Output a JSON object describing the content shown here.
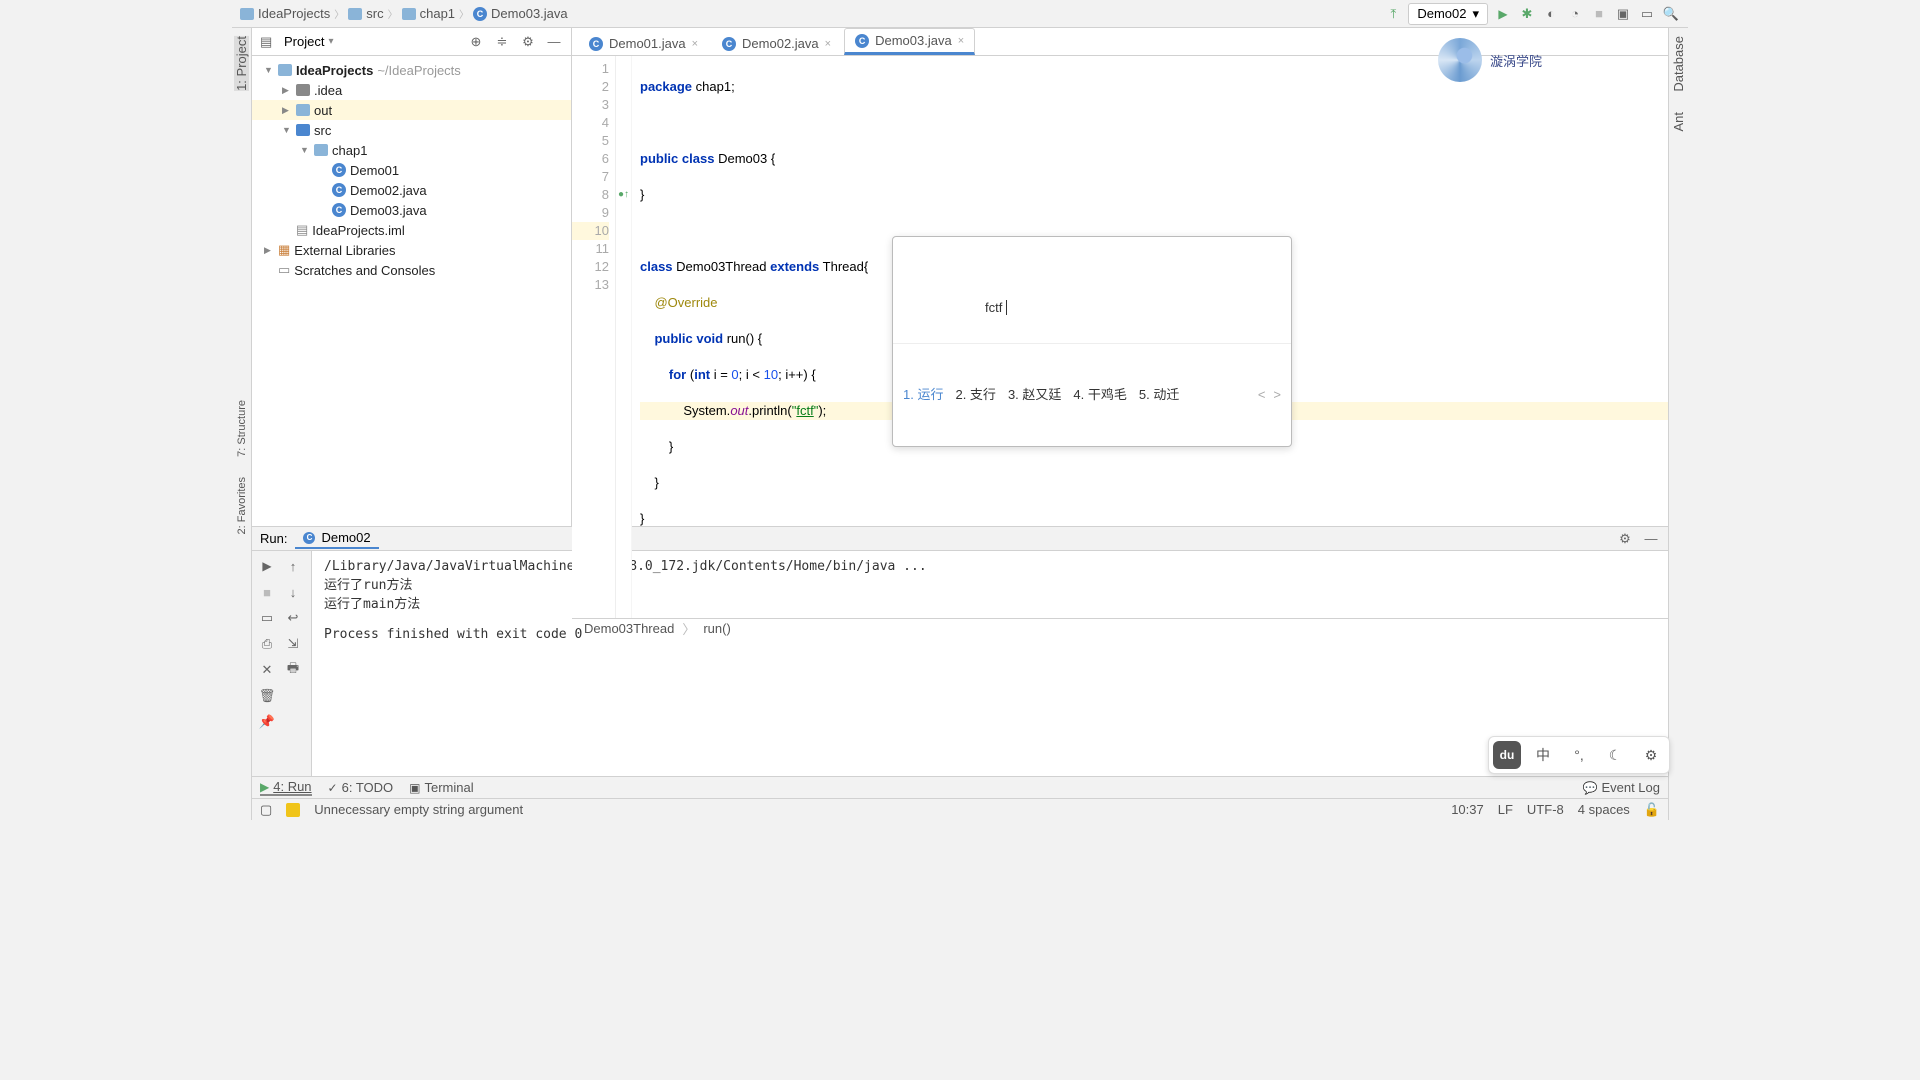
{
  "breadcrumb": [
    "IdeaProjects",
    "src",
    "chap1",
    "Demo03.java"
  ],
  "run_config": {
    "name": "Demo02"
  },
  "left_tabs": [
    "1: Project"
  ],
  "right_tabs": [
    "Database",
    "Ant"
  ],
  "project": {
    "title": "Project",
    "tree": [
      {
        "indent": 0,
        "arrow": "▼",
        "icon": "folder",
        "label": "IdeaProjects",
        "suffix": "~/IdeaProjects",
        "bold": true
      },
      {
        "indent": 1,
        "arrow": "▶",
        "icon": "folder-gray",
        "label": ".idea"
      },
      {
        "indent": 1,
        "arrow": "▶",
        "icon": "folder",
        "label": "out",
        "selected": true
      },
      {
        "indent": 1,
        "arrow": "▼",
        "icon": "folder-blue",
        "label": "src"
      },
      {
        "indent": 2,
        "arrow": "▼",
        "icon": "folder",
        "label": "chap1"
      },
      {
        "indent": 3,
        "arrow": "",
        "icon": "class",
        "label": "Demo01"
      },
      {
        "indent": 3,
        "arrow": "",
        "icon": "class",
        "label": "Demo02.java"
      },
      {
        "indent": 3,
        "arrow": "",
        "icon": "class",
        "label": "Demo03.java"
      },
      {
        "indent": 1,
        "arrow": "",
        "icon": "iml",
        "label": "IdeaProjects.iml"
      },
      {
        "indent": 0,
        "arrow": "▶",
        "icon": "lib",
        "label": "External Libraries"
      },
      {
        "indent": 0,
        "arrow": "",
        "icon": "scratch",
        "label": "Scratches and Consoles"
      }
    ]
  },
  "editor": {
    "tabs": [
      {
        "label": "Demo01.java",
        "active": false
      },
      {
        "label": "Demo02.java",
        "active": false
      },
      {
        "label": "Demo03.java",
        "active": true
      }
    ],
    "lines": [
      1,
      2,
      3,
      4,
      5,
      6,
      7,
      8,
      9,
      10,
      11,
      12,
      13
    ],
    "current_line": 10,
    "breadcrumb": [
      "Demo03Thread",
      "run()"
    ]
  },
  "code": {
    "l1_pkg": "package",
    "l1_name": "chap1;",
    "l3_pub": "public",
    "l3_cls": "class",
    "l3_name": "Demo03",
    "l3_brace": " {",
    "l4": "}",
    "l6_cls": "class",
    "l6_name": "Demo03Thread",
    "l6_ext": "extends",
    "l6_sup": "Thread",
    "l6_brace": "{",
    "l7_ann": "@Override",
    "l8_pub": "public",
    "l8_void": "void",
    "l8_run": "run()",
    "l8_brace": " {",
    "l9_for": "for",
    "l9_open": " (",
    "l9_int": "int",
    "l9_i1": " i = ",
    "l9_0": "0",
    "l9_semi1": "; ",
    "l9_i2": "i < ",
    "l9_10": "10",
    "l9_semi2": "; ",
    "l9_inc": "i++",
    "l9_close": ") {",
    "l10_sys": "System.",
    "l10_out": "out",
    "l10_println": ".println(",
    "l10_q1": "\"",
    "l10_str": "fctf",
    "l10_q2": "\"",
    "l10_end": ");",
    "l11": "        }",
    "l12": "    }",
    "l13": "}"
  },
  "ime": {
    "input": "fctf",
    "candidates": [
      {
        "n": "1.",
        "text": "运行"
      },
      {
        "n": "2.",
        "text": "支行"
      },
      {
        "n": "3.",
        "text": "赵又廷"
      },
      {
        "n": "4.",
        "text": "干鸡毛"
      },
      {
        "n": "5.",
        "text": "动迁"
      }
    ]
  },
  "watermark": "漩涡学院",
  "run": {
    "title": "Run:",
    "tab": "Demo02",
    "output": "/Library/Java/JavaVirtualMachines/jdk1.8.0_172.jdk/Contents/Home/bin/java ...\n运行了run方法\n运行了main方法\n\nProcess finished with exit code 0"
  },
  "tool_tabs": {
    "run": "4: Run",
    "todo": "6: TODO",
    "terminal": "Terminal",
    "event_log": "Event Log"
  },
  "status": {
    "message": "Unnecessary empty string argument",
    "caret": "10:37",
    "lf": "LF",
    "enc": "UTF-8",
    "indent": "4 spaces"
  },
  "ime_toolbar": [
    "du",
    "中",
    "°,",
    "☾",
    "⚙"
  ]
}
